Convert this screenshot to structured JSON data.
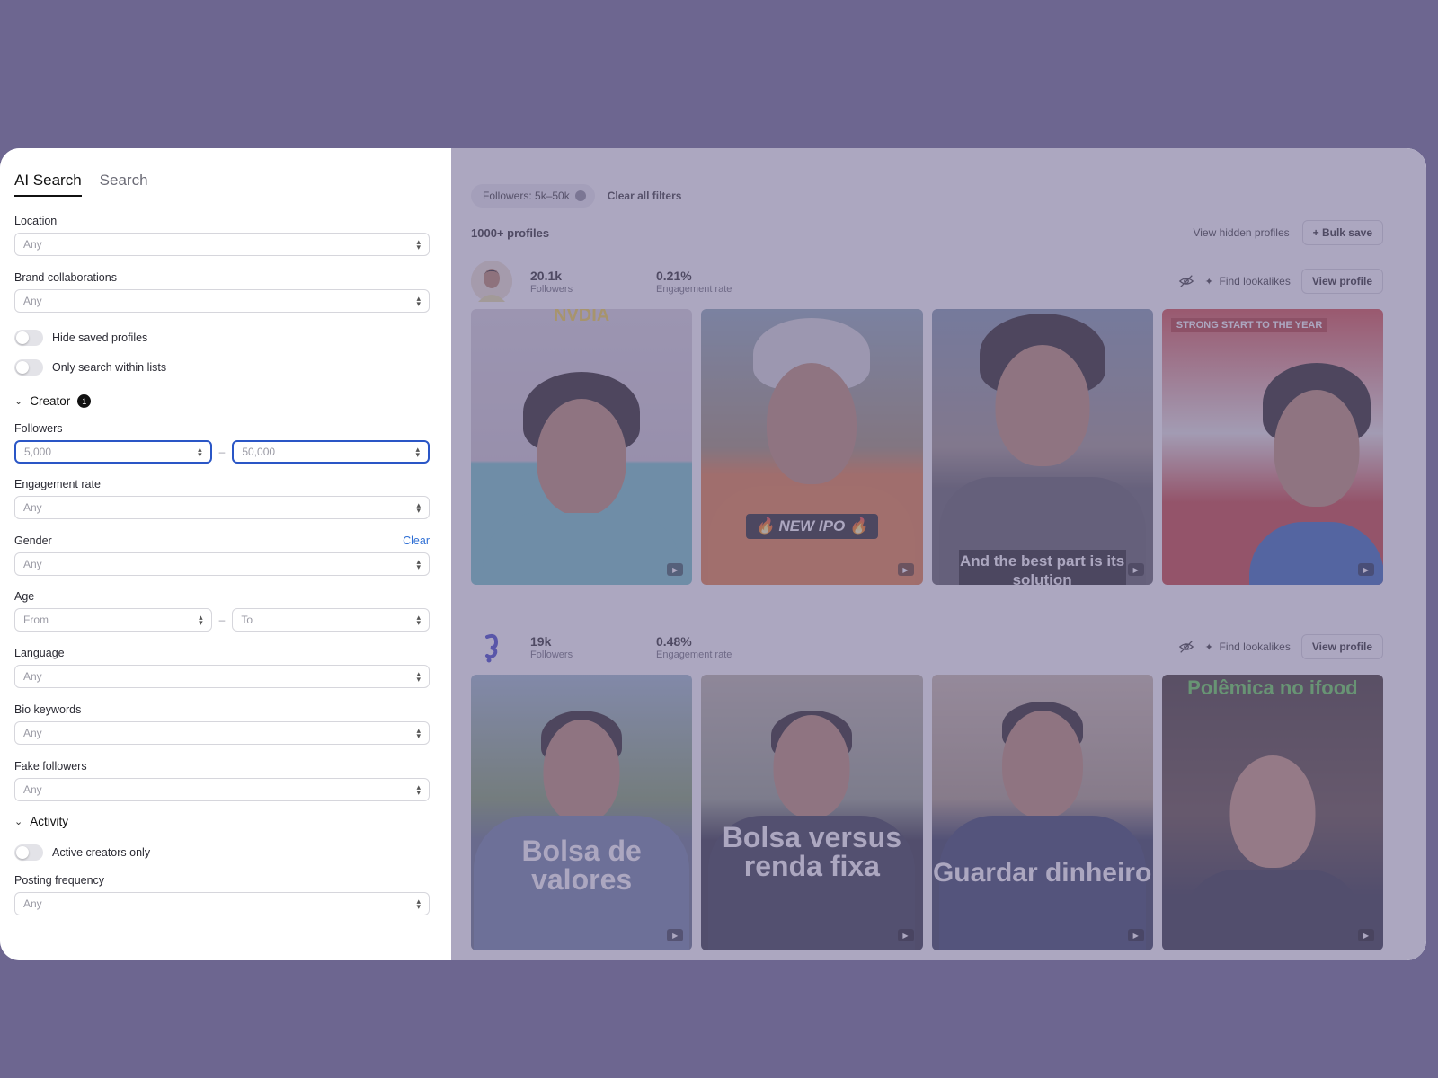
{
  "sidebar": {
    "tabs": [
      {
        "label": "AI Search",
        "active": true
      },
      {
        "label": "Search",
        "active": false
      }
    ],
    "location": {
      "label": "Location",
      "value": "Any"
    },
    "brand_collaborations": {
      "label": "Brand collaborations",
      "value": "Any"
    },
    "toggles": {
      "hide_saved": "Hide saved profiles",
      "only_lists": "Only search within lists",
      "active_only": "Active creators only"
    },
    "creator_section": {
      "label": "Creator",
      "badge": "1"
    },
    "followers": {
      "label": "Followers",
      "min_placeholder": "5,000",
      "max_placeholder": "50,000"
    },
    "engagement_rate": {
      "label": "Engagement rate",
      "value": "Any"
    },
    "gender": {
      "label": "Gender",
      "clear": "Clear",
      "value": "Any"
    },
    "age": {
      "label": "Age",
      "from": "From",
      "to": "To",
      "dash": "–"
    },
    "language": {
      "label": "Language",
      "value": "Any"
    },
    "bio_keywords": {
      "label": "Bio keywords",
      "value": "Any"
    },
    "fake_followers": {
      "label": "Fake followers",
      "value": "Any"
    },
    "activity_section": {
      "label": "Activity"
    },
    "posting_frequency": {
      "label": "Posting frequency",
      "value": "Any"
    }
  },
  "main": {
    "filter_chip": "Followers: 5k–50k",
    "clear_all": "Clear all filters",
    "results_count": "1000+ profiles",
    "view_hidden": "View hidden profiles",
    "bulk_save": "+ Bulk save",
    "find_lookalikes": "Find lookalikes",
    "view_profile": "View profile",
    "profiles": [
      {
        "followers": "20.1k",
        "followers_label": "Followers",
        "engagement": "0.21%",
        "engagement_label": "Engagement rate",
        "captions": [
          "NVDIA",
          "🔥 NEW IPO 🔥",
          "And the best part is its solution",
          "STRONG START TO THE YEAR"
        ]
      },
      {
        "followers": "19k",
        "followers_label": "Followers",
        "engagement": "0.48%",
        "engagement_label": "Engagement rate",
        "captions": [
          "Bolsa de valores",
          "Bolsa versus renda fixa",
          "Guardar dinheiro",
          "Polêmica no ifood"
        ]
      }
    ]
  },
  "colors": {
    "backdrop": "#6d6690",
    "accent": "#2a56c6",
    "link": "#2f6fd4"
  }
}
